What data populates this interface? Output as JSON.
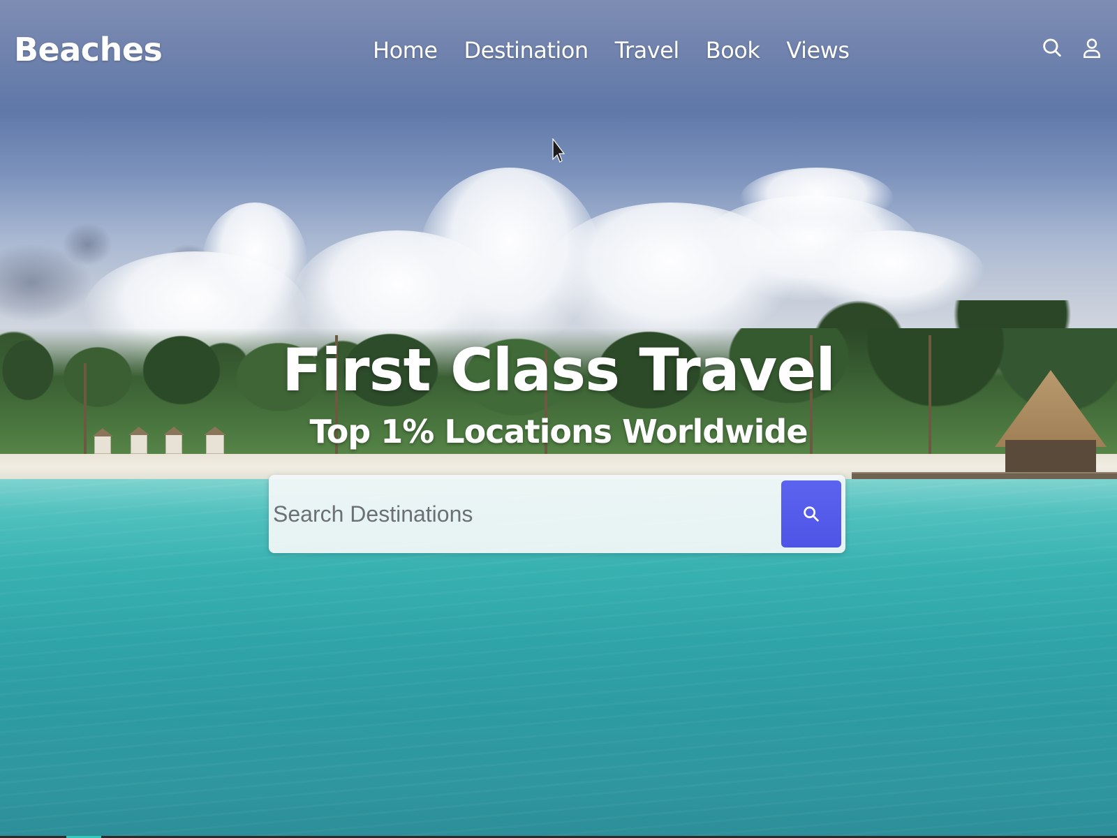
{
  "brand": {
    "name": "Beaches"
  },
  "nav": {
    "links": [
      {
        "label": "Home"
      },
      {
        "label": "Destination"
      },
      {
        "label": "Travel"
      },
      {
        "label": "Book"
      },
      {
        "label": "Views"
      }
    ],
    "icons": {
      "search": "search-icon",
      "account": "user-icon"
    }
  },
  "hero": {
    "title": "First Class Travel",
    "subtitle": "Top 1% Locations Worldwide"
  },
  "search": {
    "placeholder": "Search Destinations",
    "value": "",
    "button_icon": "search-icon"
  },
  "colors": {
    "accent": "#5057e8",
    "text_light": "#ffffff"
  }
}
